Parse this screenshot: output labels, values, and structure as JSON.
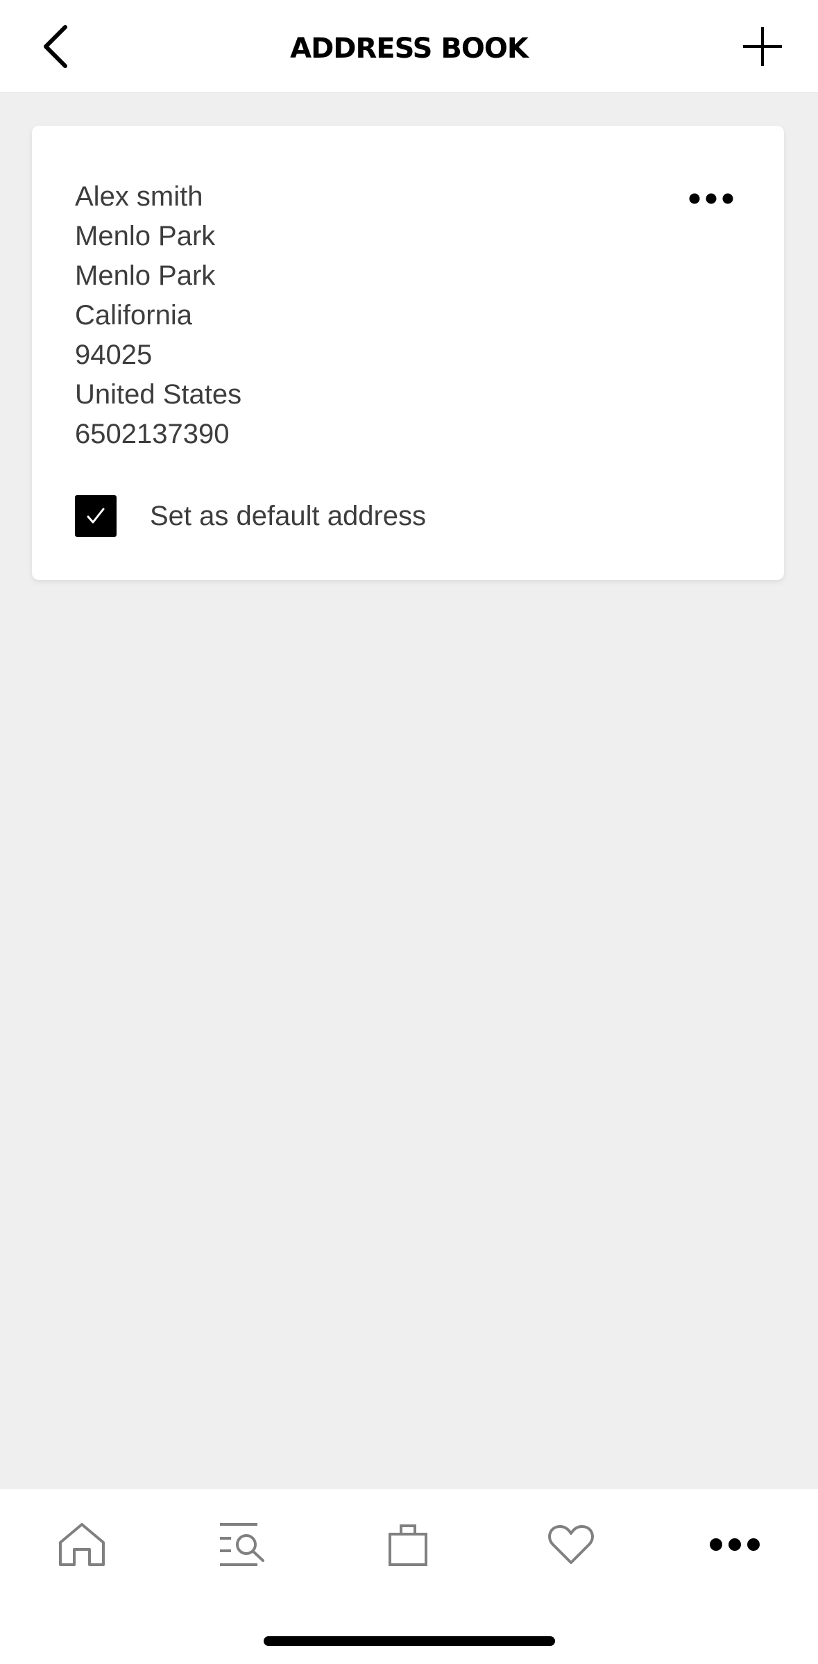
{
  "header": {
    "title": "ADDRESS BOOK",
    "back_icon": "chevron-left-icon",
    "add_icon": "plus-icon"
  },
  "address_card": {
    "lines": [
      "Alex smith",
      "Menlo Park",
      "Menlo Park",
      "California",
      "94025",
      "United States",
      "6502137390"
    ],
    "more_icon": "ellipsis-icon",
    "default_label": "Set as default address",
    "default_checked": true
  },
  "tabbar": {
    "items": [
      {
        "name": "home",
        "icon": "home-icon",
        "active": false
      },
      {
        "name": "search",
        "icon": "search-list-icon",
        "active": false
      },
      {
        "name": "bag",
        "icon": "shopping-bag-icon",
        "active": false
      },
      {
        "name": "wishlist",
        "icon": "heart-icon",
        "active": false
      },
      {
        "name": "more",
        "icon": "ellipsis-icon",
        "active": true
      }
    ]
  },
  "colors": {
    "background": "#efefef",
    "card": "#ffffff",
    "text": "#3d3d3d",
    "accent": "#000000",
    "inactive_icon": "#808080"
  }
}
